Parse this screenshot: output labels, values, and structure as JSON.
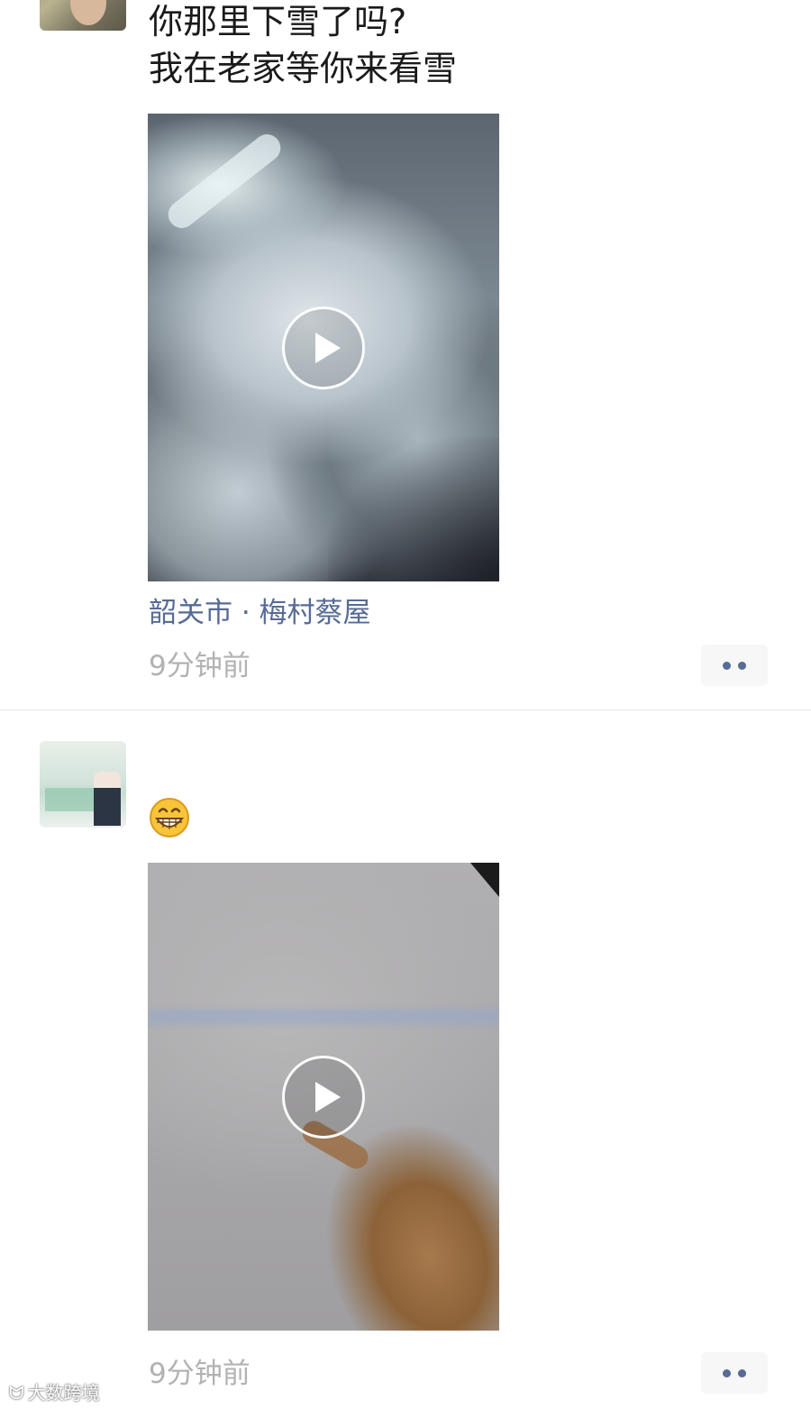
{
  "posts": [
    {
      "caption_lines": [
        "你那里下雪了吗?",
        "我在老家等你来看雪"
      ],
      "video": {
        "play_icon": "play-icon"
      },
      "location": "韶关市 · 梅村蔡屋",
      "time": "9分钟前",
      "more_icon": "more-dots-icon"
    },
    {
      "username": "",
      "emoji": "grinning-face-icon",
      "video": {
        "play_icon": "play-icon"
      },
      "time": "9分钟前",
      "more_icon": "more-dots-icon"
    }
  ],
  "watermark": {
    "text": "大数跨境"
  },
  "colors": {
    "link": "#576b95",
    "time": "#b2b2b2",
    "text": "#1a1a1a",
    "divider": "#e6e6e6"
  }
}
